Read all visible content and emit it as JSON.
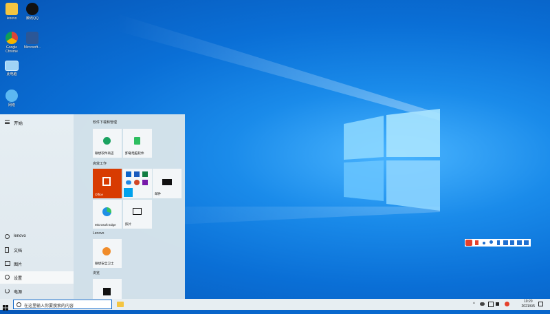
{
  "desktop": {
    "icons": [
      {
        "label": "lenovo"
      },
      {
        "label": "腾讯QQ"
      },
      {
        "label": "Google Chrome"
      },
      {
        "label": "Microsoft..."
      },
      {
        "label": "此电脑"
      },
      {
        "label": "网络"
      }
    ]
  },
  "start_menu": {
    "title": "开始",
    "rail": {
      "user": "lenovo",
      "documents": "文档",
      "pictures": "图片",
      "settings": "设置",
      "power": "电源"
    },
    "groups": {
      "g1": "软件下载和管理",
      "g2": "高效工作",
      "g3": "Lenovo",
      "g4": "浏览"
    },
    "tiles": {
      "t1": "联想软件商店",
      "t2": "卸载电脑软件",
      "office": "Office",
      "mail": "邮件",
      "edge": "Microsoft Edge",
      "photos": "照片",
      "lenovo_app": "联想安全卫士"
    }
  },
  "taskbar": {
    "search_placeholder": "在这里输入你要搜索的内容",
    "time": "10:20",
    "date": "2021/6/5"
  },
  "colors": {
    "office_tile": "#d83b01",
    "accent": "#0078d7",
    "taskbar": "#e7eef2"
  }
}
